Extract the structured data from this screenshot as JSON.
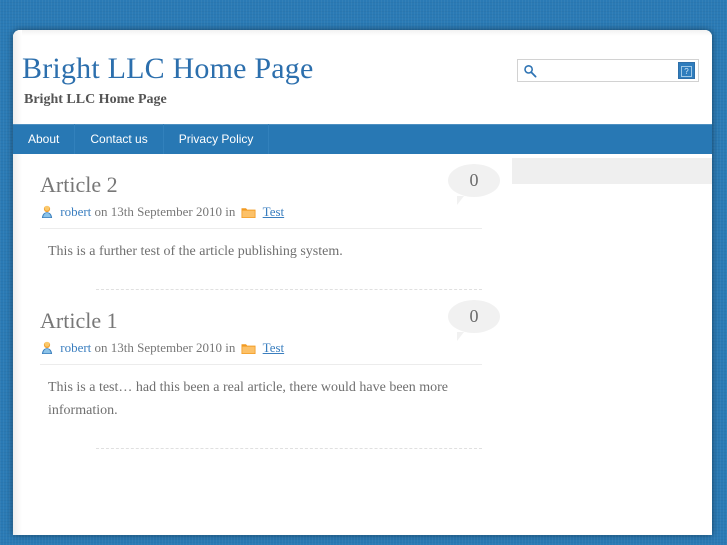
{
  "site": {
    "title": "Bright LLC Home Page",
    "description": "Bright LLC Home Page",
    "bg_color": "#2a7ab5",
    "nav_color": "#2878b4",
    "title_color": "#2c6fad",
    "link_color": "#3a7ebf"
  },
  "search": {
    "value": "",
    "placeholder": "",
    "icon": "search-icon",
    "submit_label": "?",
    "submit_icon": "broken-image-icon"
  },
  "nav": {
    "items": [
      {
        "label": "About"
      },
      {
        "label": "Contact us"
      },
      {
        "label": "Privacy Policy"
      }
    ]
  },
  "posts": [
    {
      "title": "Article 2",
      "author_icon": "user-icon",
      "author": "robert",
      "meta_on": "on",
      "date": "13th September 2010",
      "meta_in": "in",
      "category_icon": "folder-icon",
      "category": "Test",
      "content": "This is a further test of the article publishing system.",
      "comment_count": "0"
    },
    {
      "title": "Article 1",
      "author_icon": "user-icon",
      "author": "robert",
      "meta_on": "on",
      "date": "13th September 2010",
      "meta_in": "in",
      "category_icon": "folder-icon",
      "category": "Test",
      "content": "This is a test… had this been a real article, there would have been more information.",
      "comment_count": "0"
    }
  ],
  "sidebar": {
    "widgets": [
      {
        "label": ""
      }
    ]
  }
}
